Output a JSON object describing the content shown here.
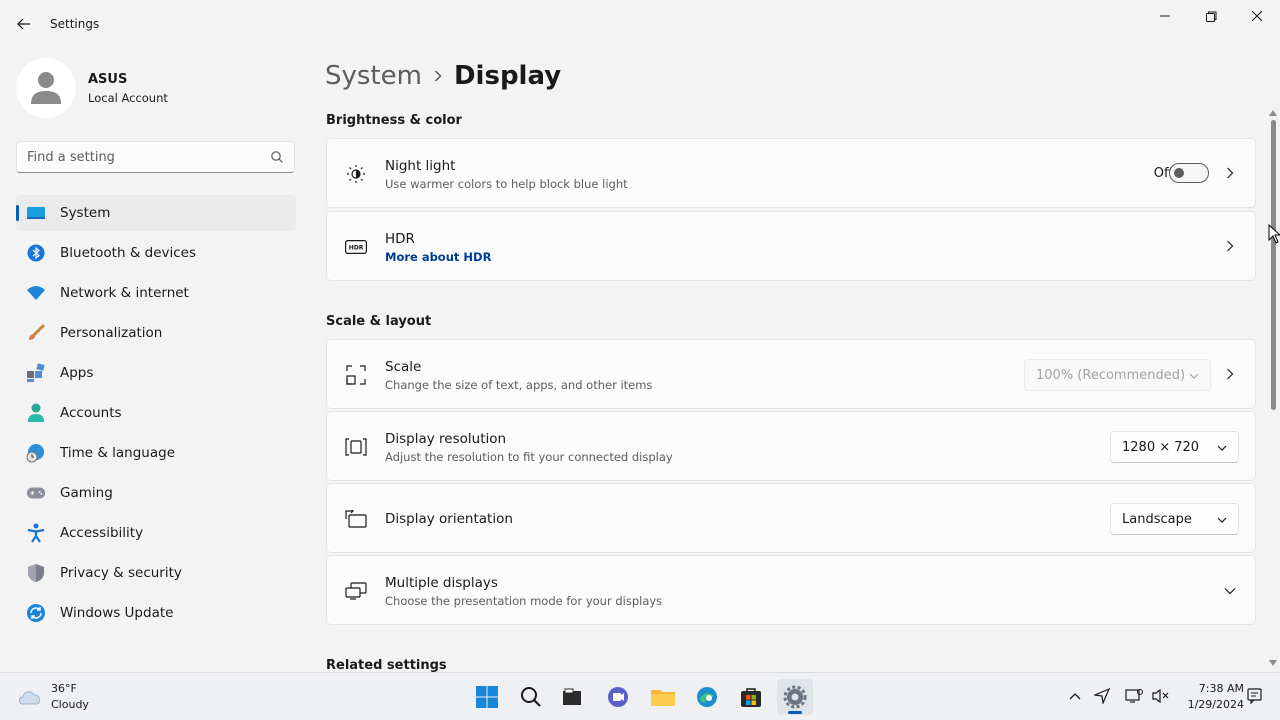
{
  "window": {
    "title": "Settings"
  },
  "profile": {
    "name": "ASUS",
    "account_type": "Local Account"
  },
  "search": {
    "placeholder": "Find a setting"
  },
  "sidebar": {
    "items": [
      {
        "label": "System",
        "icon": "laptop-icon",
        "active": true
      },
      {
        "label": "Bluetooth & devices",
        "icon": "bluetooth-icon"
      },
      {
        "label": "Network & internet",
        "icon": "wifi-icon"
      },
      {
        "label": "Personalization",
        "icon": "brush-icon"
      },
      {
        "label": "Apps",
        "icon": "apps-icon"
      },
      {
        "label": "Accounts",
        "icon": "person-icon"
      },
      {
        "label": "Time & language",
        "icon": "globe-clock-icon"
      },
      {
        "label": "Gaming",
        "icon": "gamepad-icon"
      },
      {
        "label": "Accessibility",
        "icon": "accessibility-icon"
      },
      {
        "label": "Privacy & security",
        "icon": "shield-icon"
      },
      {
        "label": "Windows Update",
        "icon": "update-icon"
      }
    ]
  },
  "breadcrumb": {
    "parent": "System",
    "current": "Display"
  },
  "sections": {
    "brightness": "Brightness & color",
    "scale_layout": "Scale & layout",
    "related": "Related settings"
  },
  "cards": {
    "night_light": {
      "title": "Night light",
      "subtitle": "Use warmer colors to help block blue light",
      "toggle_state": "Off",
      "icon": "sun-moon-icon"
    },
    "hdr": {
      "title": "HDR",
      "link": "More about HDR",
      "icon": "hdr-icon"
    },
    "scale": {
      "title": "Scale",
      "subtitle": "Change the size of text, apps, and other items",
      "value": "100% (Recommended)",
      "icon": "scale-icon"
    },
    "resolution": {
      "title": "Display resolution",
      "subtitle": "Adjust the resolution to fit your connected display",
      "value": "1280 × 720",
      "icon": "resolution-icon"
    },
    "orientation": {
      "title": "Display orientation",
      "value": "Landscape",
      "icon": "orientation-icon"
    },
    "multiple": {
      "title": "Multiple displays",
      "subtitle": "Choose the presentation mode for your displays",
      "icon": "multiple-displays-icon"
    }
  },
  "taskbar": {
    "weather_temp": "36°F",
    "weather_condition": "Cloudy",
    "apps": [
      "windows-start-icon",
      "search-icon",
      "file-manager-icon",
      "teams-icon",
      "folder-icon",
      "edge-icon",
      "store-icon",
      "settings-icon"
    ],
    "time": "7:38 AM",
    "date": "1/29/2024"
  },
  "colors": {
    "accent": "#005fb8",
    "link": "#003e92",
    "background": "#f3f3f3",
    "card": "#fbfbfb"
  }
}
